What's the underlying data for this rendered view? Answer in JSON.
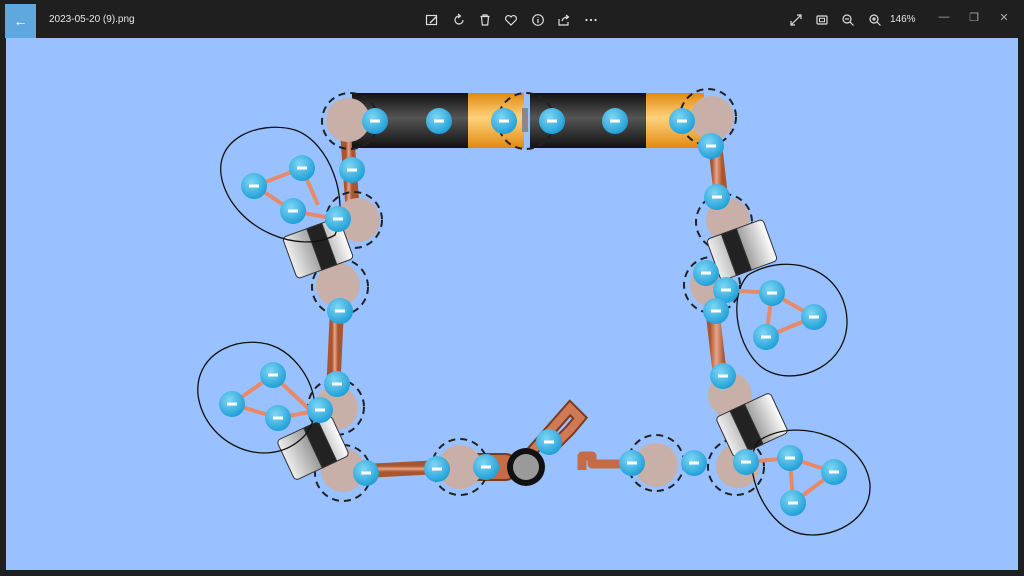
{
  "window": {
    "filename": "2023-05-20 (9).png",
    "zoom_label": "146%"
  },
  "toolbar": {
    "items": [
      {
        "name": "edit-image-icon"
      },
      {
        "name": "rotate-icon"
      },
      {
        "name": "delete-icon"
      },
      {
        "name": "favorite-icon"
      },
      {
        "name": "info-icon"
      },
      {
        "name": "share-icon"
      },
      {
        "name": "more-icon"
      }
    ],
    "right_items": [
      {
        "name": "fullscreen-icon"
      },
      {
        "name": "fit-to-window-icon"
      },
      {
        "name": "zoom-out-icon"
      },
      {
        "name": "zoom-in-icon"
      }
    ]
  },
  "colors": {
    "titlebar": "#1f1f1f",
    "accent": "#5ea8df",
    "canvas": "#99c1ff",
    "wire": "#c8774f",
    "electron": "#29aee3",
    "battery_black": "#111111",
    "battery_orange": "#f5a623"
  }
}
